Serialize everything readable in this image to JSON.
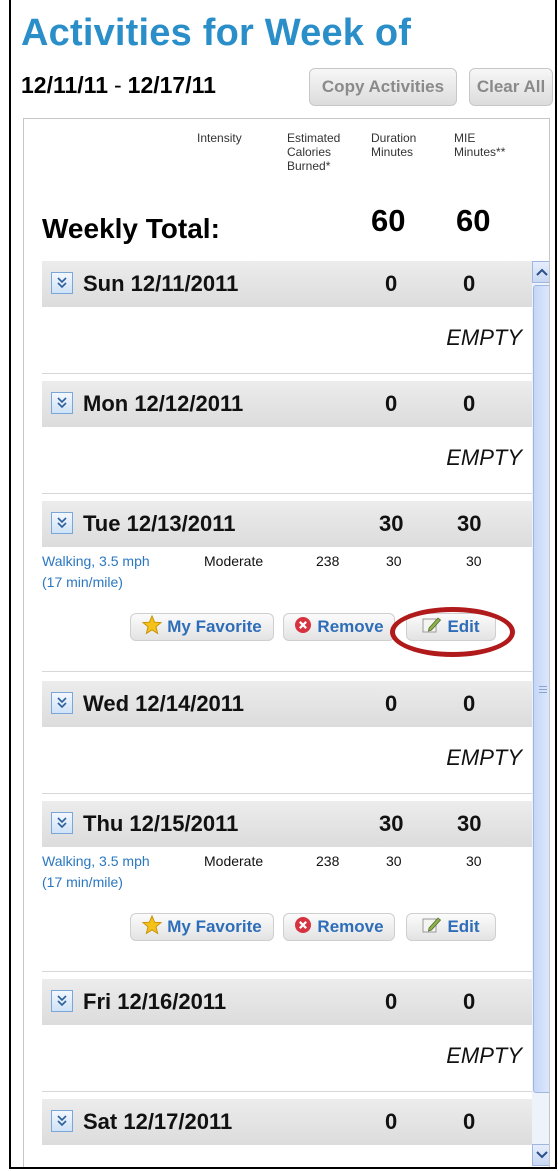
{
  "page": {
    "title": "Activities for Week of",
    "range_start": "12/11/11",
    "range_sep": "-",
    "range_end": "12/17/11",
    "copy_label": "Copy Activities",
    "clear_label": "Clear All"
  },
  "columns": {
    "intensity": "Intensity",
    "calories": "Estimated\nCalories\nBurned*",
    "duration": "Duration\nMinutes",
    "mie": "MIE\nMinutes**"
  },
  "weekly": {
    "label": "Weekly Total:",
    "duration": "60",
    "mie": "60"
  },
  "days": [
    {
      "label": "Sun 12/11/2011",
      "duration": "0",
      "mie": "0",
      "empty": "EMPTY"
    },
    {
      "label": "Mon 12/12/2011",
      "duration": "0",
      "mie": "0",
      "empty": "EMPTY"
    },
    {
      "label": "Tue 12/13/2011",
      "duration": "30",
      "mie": "30",
      "activity": {
        "name_line1": "Walking, 3.5 mph",
        "name_line2": "(17 min/mile)",
        "intensity": "Moderate",
        "calories": "238",
        "duration": "30",
        "mie": "30"
      }
    },
    {
      "label": "Wed 12/14/2011",
      "duration": "0",
      "mie": "0",
      "empty": "EMPTY"
    },
    {
      "label": "Thu 12/15/2011",
      "duration": "30",
      "mie": "30",
      "activity": {
        "name_line1": "Walking, 3.5 mph",
        "name_line2": "(17 min/mile)",
        "intensity": "Moderate",
        "calories": "238",
        "duration": "30",
        "mie": "30"
      }
    },
    {
      "label": "Fri 12/16/2011",
      "duration": "0",
      "mie": "0",
      "empty": "EMPTY"
    },
    {
      "label": "Sat 12/17/2011",
      "duration": "0",
      "mie": "0"
    }
  ],
  "actions": {
    "favorite": "My Favorite",
    "remove": "Remove",
    "edit": "Edit"
  },
  "icons": {
    "toggle": "chevron-double-down-icon",
    "favorite": "star-icon",
    "remove": "remove-x-icon",
    "edit": "edit-pencil-icon"
  },
  "colors": {
    "title": "#2a8fc9",
    "link": "#2a77c0",
    "highlight_circle": "#b11a1a"
  }
}
